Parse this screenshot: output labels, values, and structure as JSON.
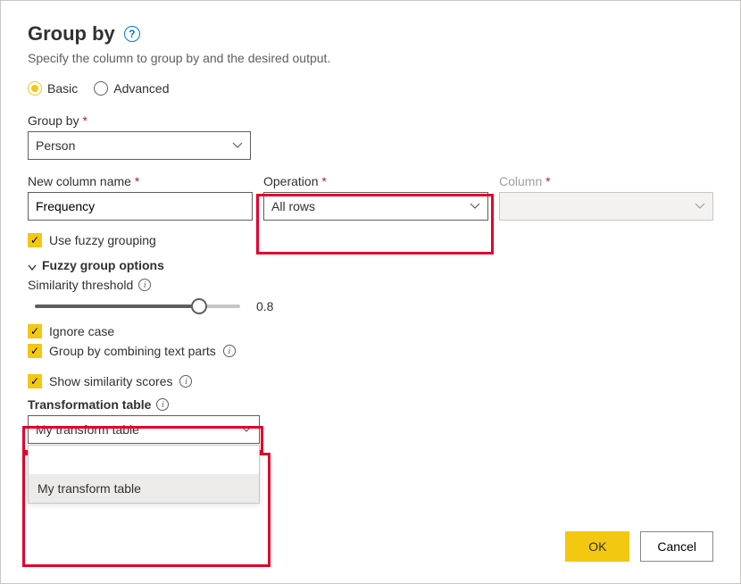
{
  "title": "Group by",
  "subtitle": "Specify the column to group by and the desired output.",
  "mode": {
    "basic": "Basic",
    "advanced": "Advanced",
    "selected": "basic"
  },
  "group_by": {
    "label": "Group by",
    "value": "Person"
  },
  "new_column": {
    "label": "New column name",
    "value": "Frequency"
  },
  "operation": {
    "label": "Operation",
    "value": "All rows"
  },
  "column": {
    "label": "Column",
    "value": ""
  },
  "fuzzy": {
    "use_label": "Use fuzzy grouping",
    "section_label": "Fuzzy group options",
    "threshold_label": "Similarity threshold",
    "threshold_value": "0.8",
    "threshold_pct": 80,
    "ignore_case": "Ignore case",
    "combine_parts": "Group by combining text parts",
    "show_scores": "Show similarity scores",
    "trans_table_label": "Transformation table",
    "trans_table_value": "My transform table",
    "trans_table_option": "My transform table"
  },
  "footer": {
    "ok": "OK",
    "cancel": "Cancel"
  }
}
